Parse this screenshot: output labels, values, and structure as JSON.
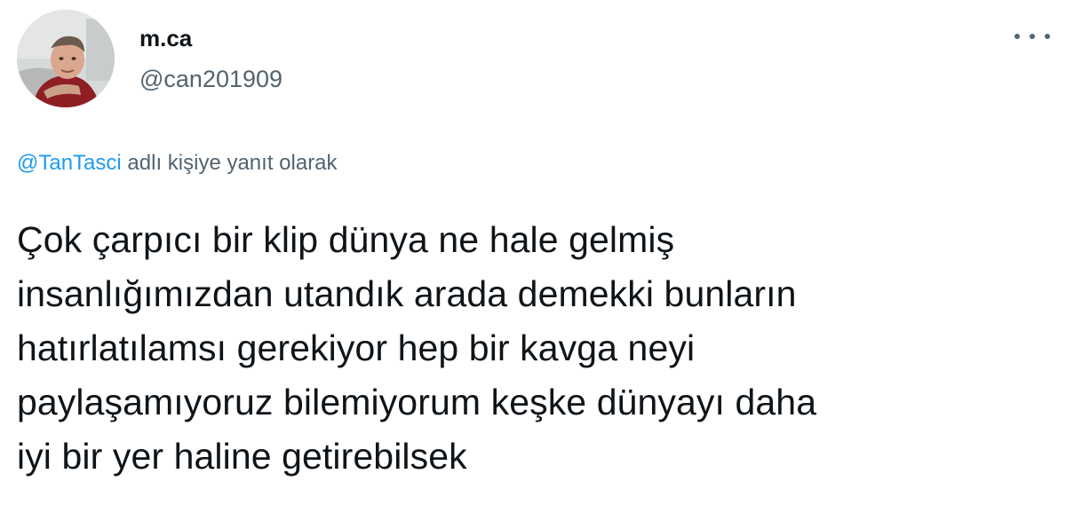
{
  "author": {
    "display_name": "m.ca",
    "handle": "@can201909",
    "avatar_icon": "user-avatar-photo"
  },
  "menu": {
    "icon": "more-horizontal-icon"
  },
  "reply": {
    "mention": "@TanTasci",
    "suffix": " adlı kişiye yanıt olarak"
  },
  "tweet": {
    "text": "Çok çarpıcı bir klip dünya ne hale gelmiş\ninsanlığımızdan utandık arada demekki bunların\nhatırlatılamsı gerekiyor hep bir kavga neyi\npaylaşamıyoruz bilemiyorum keşke dünyayı daha\niyi bir yer haline getirebilsek"
  },
  "colors": {
    "text": "#0f1419",
    "secondary": "#536471",
    "link": "#1d9bf0",
    "background": "#ffffff"
  }
}
